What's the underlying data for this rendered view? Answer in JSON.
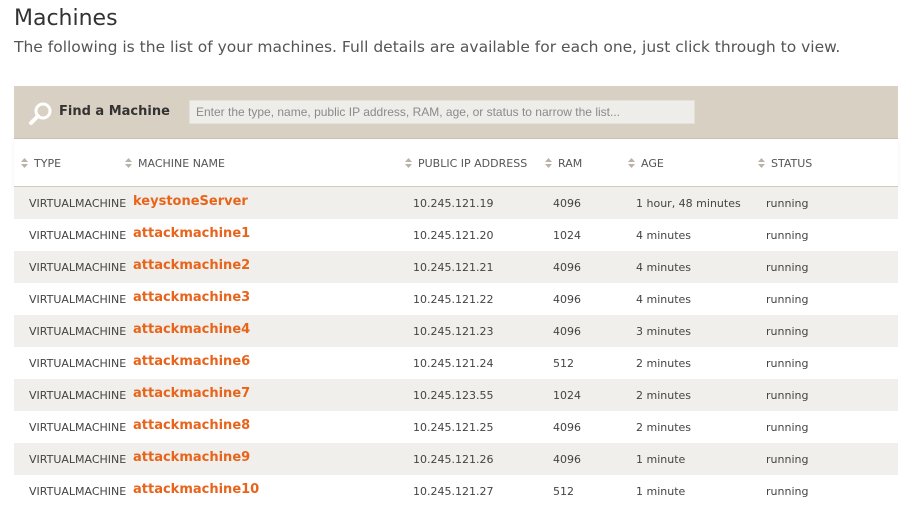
{
  "page": {
    "title": "Machines",
    "subtitle": "The following is the list of your machines. Full details are available for each one, just click through to view."
  },
  "search": {
    "label": "Find a Machine",
    "placeholder": "Enter the type, name, public IP address, RAM, age, or status to narrow the list...",
    "icon": "search-icon"
  },
  "colors": {
    "accent": "#e8641b",
    "search_bar": "#d9d0c4",
    "row_alt": "#f1efeb"
  },
  "table": {
    "columns": [
      "TYPE",
      "MACHINE NAME",
      "PUBLIC IP ADDRESS",
      "RAM",
      "AGE",
      "STATUS"
    ],
    "rows": [
      {
        "type": "VIRTUALMACHINE",
        "name": "keystoneServer",
        "ip": "10.245.121.19",
        "ram": "4096",
        "age": "1 hour, 48 minutes",
        "status": "running"
      },
      {
        "type": "VIRTUALMACHINE",
        "name": "attackmachine1",
        "ip": "10.245.121.20",
        "ram": "1024",
        "age": "4 minutes",
        "status": "running"
      },
      {
        "type": "VIRTUALMACHINE",
        "name": "attackmachine2",
        "ip": "10.245.121.21",
        "ram": "4096",
        "age": "4 minutes",
        "status": "running"
      },
      {
        "type": "VIRTUALMACHINE",
        "name": "attackmachine3",
        "ip": "10.245.121.22",
        "ram": "4096",
        "age": "4 minutes",
        "status": "running"
      },
      {
        "type": "VIRTUALMACHINE",
        "name": "attackmachine4",
        "ip": "10.245.121.23",
        "ram": "4096",
        "age": "3 minutes",
        "status": "running"
      },
      {
        "type": "VIRTUALMACHINE",
        "name": "attackmachine6",
        "ip": "10.245.121.24",
        "ram": "512",
        "age": "2 minutes",
        "status": "running"
      },
      {
        "type": "VIRTUALMACHINE",
        "name": "attackmachine7",
        "ip": "10.245.123.55",
        "ram": "1024",
        "age": "2 minutes",
        "status": "running"
      },
      {
        "type": "VIRTUALMACHINE",
        "name": "attackmachine8",
        "ip": "10.245.121.25",
        "ram": "4096",
        "age": "2 minutes",
        "status": "running"
      },
      {
        "type": "VIRTUALMACHINE",
        "name": "attackmachine9",
        "ip": "10.245.121.26",
        "ram": "4096",
        "age": "1 minute",
        "status": "running"
      },
      {
        "type": "VIRTUALMACHINE",
        "name": "attackmachine10",
        "ip": "10.245.121.27",
        "ram": "512",
        "age": "1 minute",
        "status": "running"
      }
    ]
  }
}
